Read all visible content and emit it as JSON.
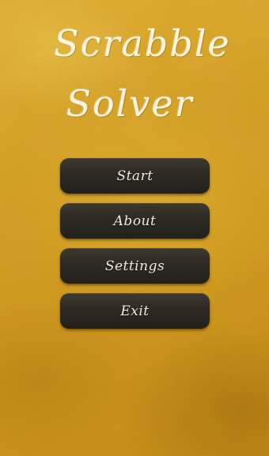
{
  "app": {
    "title_line_1": "Scrabble",
    "title_line_2": "Solver"
  },
  "menu": {
    "start_label": "Start",
    "about_label": "About",
    "settings_label": "Settings",
    "exit_label": "Exit"
  },
  "colors": {
    "background_gold": "#dca52c",
    "button_dark": "#2e2a23",
    "text_cream": "#fbf4e0"
  }
}
